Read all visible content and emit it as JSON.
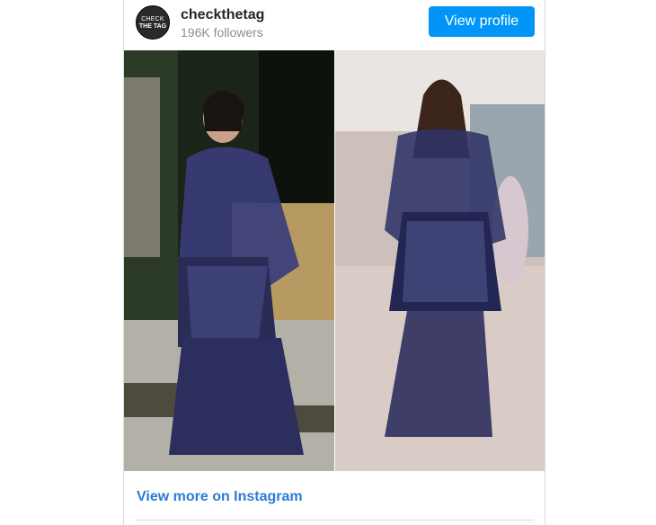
{
  "profile": {
    "avatar_line1": "CHECK",
    "avatar_line2": "THE TAG",
    "username": "checkthetag",
    "followers": "196K followers",
    "view_profile_label": "View profile"
  },
  "footer": {
    "view_more_label": "View more on Instagram"
  },
  "colors": {
    "accent": "#0095f6",
    "link": "#2b7bd6",
    "dress": "#2c2f5e"
  }
}
